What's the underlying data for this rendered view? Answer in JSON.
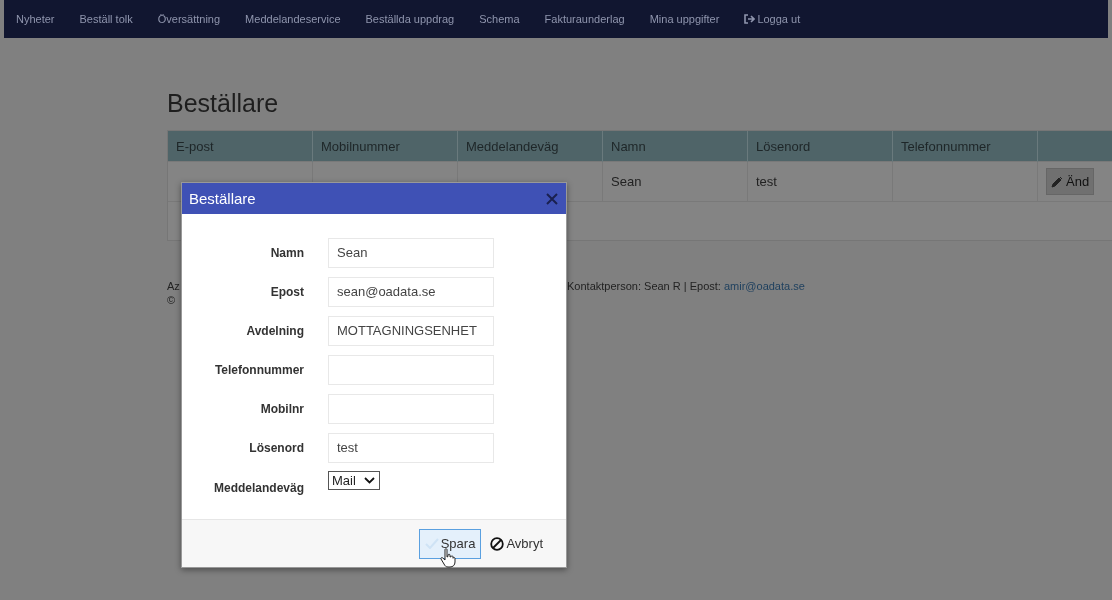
{
  "nav": {
    "items": [
      {
        "label": "Nyheter",
        "kind": "link"
      },
      {
        "label": "Beställ tolk",
        "kind": "link"
      },
      {
        "label": "Översättning",
        "kind": "link"
      },
      {
        "label": "Meddelandeservice",
        "kind": "link"
      },
      {
        "label": "Beställda uppdrag",
        "kind": "link"
      },
      {
        "label": "Schema",
        "kind": "link"
      },
      {
        "label": "Fakturaunderlag",
        "kind": "link"
      },
      {
        "label": "Mina uppgifter",
        "kind": "link"
      },
      {
        "label": "Logga ut",
        "kind": "logout"
      }
    ]
  },
  "page": {
    "title": "Beställare"
  },
  "table": {
    "columns": [
      "E-post",
      "Mobilnummer",
      "Meddelandeväg",
      "Namn",
      "Lösenord",
      "Telefonnummer"
    ],
    "rows": [
      {
        "namn": "Sean",
        "losenord": "test",
        "action": "Änd"
      }
    ]
  },
  "footer": {
    "line_1_start": "Az",
    "contact": "Kontaktperson: Sean R | Epost:",
    "contact_email": "amir@oadata.se",
    "line_2_start": "©"
  },
  "dialog": {
    "title": "Beställare",
    "fields": [
      {
        "label": "Namn",
        "kind": "text",
        "value": "Sean"
      },
      {
        "label": "Epost",
        "kind": "text",
        "value": "sean@oadata.se"
      },
      {
        "label": "Avdelning",
        "kind": "text",
        "value": "MOTTAGNINGSENHET"
      },
      {
        "label": "Telefonnummer",
        "kind": "text"
      },
      {
        "label": "Mobilnr",
        "kind": "text"
      },
      {
        "label": "Lösenord",
        "kind": "text",
        "value": "test"
      },
      {
        "label": "Meddelandeväg",
        "kind": "select",
        "value": "Mail"
      }
    ],
    "buttons": [
      {
        "label": "Spara",
        "kind": "save",
        "hovered": true
      },
      {
        "label": "Avbryt",
        "kind": "cancel",
        "hovered": false
      }
    ]
  }
}
